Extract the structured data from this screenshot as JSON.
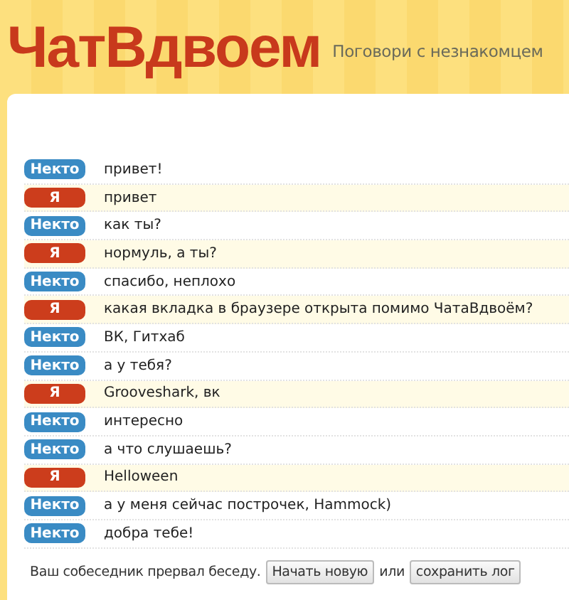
{
  "header": {
    "logo": "ЧатВдвоем",
    "tagline": "Поговори с незнакомцем"
  },
  "messages": [
    {
      "kind": "stranger",
      "author": "Некто",
      "text": "привет!"
    },
    {
      "kind": "me",
      "author": "Я",
      "text": "привет"
    },
    {
      "kind": "stranger",
      "author": "Некто",
      "text": "как ты?"
    },
    {
      "kind": "me",
      "author": "Я",
      "text": "нормуль, а ты?"
    },
    {
      "kind": "stranger",
      "author": "Некто",
      "text": "спасибо, неплохо"
    },
    {
      "kind": "me",
      "author": "Я",
      "text": "какая вкладка в браузере открыта помимо ЧатаВдвоём?"
    },
    {
      "kind": "stranger",
      "author": "Некто",
      "text": "ВК, Гитхаб"
    },
    {
      "kind": "stranger",
      "author": "Некто",
      "text": "а у тебя?"
    },
    {
      "kind": "me",
      "author": "Я",
      "text": "Grooveshark, вк"
    },
    {
      "kind": "stranger",
      "author": "Некто",
      "text": "интересно"
    },
    {
      "kind": "stranger",
      "author": "Некто",
      "text": "а что слушаешь?"
    },
    {
      "kind": "me",
      "author": "Я",
      "text": "Helloween"
    },
    {
      "kind": "stranger",
      "author": "Некто",
      "text": "а у меня сейчас построчек, Hammock)"
    },
    {
      "kind": "stranger",
      "author": "Некто",
      "text": "добра тебе!"
    }
  ],
  "footer": {
    "notice": "Ваш собеседник прервал беседу.",
    "new_button": "Начать новую",
    "or": "или",
    "save_button": "сохранить лог"
  }
}
